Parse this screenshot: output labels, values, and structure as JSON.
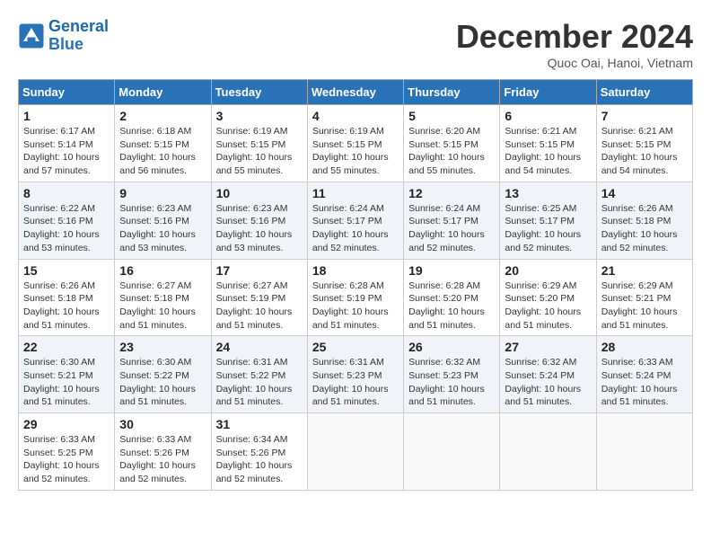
{
  "header": {
    "logo_line1": "General",
    "logo_line2": "Blue",
    "month_title": "December 2024",
    "subtitle": "Quoc Oai, Hanoi, Vietnam"
  },
  "weekdays": [
    "Sunday",
    "Monday",
    "Tuesday",
    "Wednesday",
    "Thursday",
    "Friday",
    "Saturday"
  ],
  "weeks": [
    [
      {
        "day": "1",
        "info": "Sunrise: 6:17 AM\nSunset: 5:14 PM\nDaylight: 10 hours\nand 57 minutes."
      },
      {
        "day": "2",
        "info": "Sunrise: 6:18 AM\nSunset: 5:15 PM\nDaylight: 10 hours\nand 56 minutes."
      },
      {
        "day": "3",
        "info": "Sunrise: 6:19 AM\nSunset: 5:15 PM\nDaylight: 10 hours\nand 55 minutes."
      },
      {
        "day": "4",
        "info": "Sunrise: 6:19 AM\nSunset: 5:15 PM\nDaylight: 10 hours\nand 55 minutes."
      },
      {
        "day": "5",
        "info": "Sunrise: 6:20 AM\nSunset: 5:15 PM\nDaylight: 10 hours\nand 55 minutes."
      },
      {
        "day": "6",
        "info": "Sunrise: 6:21 AM\nSunset: 5:15 PM\nDaylight: 10 hours\nand 54 minutes."
      },
      {
        "day": "7",
        "info": "Sunrise: 6:21 AM\nSunset: 5:15 PM\nDaylight: 10 hours\nand 54 minutes."
      }
    ],
    [
      {
        "day": "8",
        "info": "Sunrise: 6:22 AM\nSunset: 5:16 PM\nDaylight: 10 hours\nand 53 minutes."
      },
      {
        "day": "9",
        "info": "Sunrise: 6:23 AM\nSunset: 5:16 PM\nDaylight: 10 hours\nand 53 minutes."
      },
      {
        "day": "10",
        "info": "Sunrise: 6:23 AM\nSunset: 5:16 PM\nDaylight: 10 hours\nand 53 minutes."
      },
      {
        "day": "11",
        "info": "Sunrise: 6:24 AM\nSunset: 5:17 PM\nDaylight: 10 hours\nand 52 minutes."
      },
      {
        "day": "12",
        "info": "Sunrise: 6:24 AM\nSunset: 5:17 PM\nDaylight: 10 hours\nand 52 minutes."
      },
      {
        "day": "13",
        "info": "Sunrise: 6:25 AM\nSunset: 5:17 PM\nDaylight: 10 hours\nand 52 minutes."
      },
      {
        "day": "14",
        "info": "Sunrise: 6:26 AM\nSunset: 5:18 PM\nDaylight: 10 hours\nand 52 minutes."
      }
    ],
    [
      {
        "day": "15",
        "info": "Sunrise: 6:26 AM\nSunset: 5:18 PM\nDaylight: 10 hours\nand 51 minutes."
      },
      {
        "day": "16",
        "info": "Sunrise: 6:27 AM\nSunset: 5:18 PM\nDaylight: 10 hours\nand 51 minutes."
      },
      {
        "day": "17",
        "info": "Sunrise: 6:27 AM\nSunset: 5:19 PM\nDaylight: 10 hours\nand 51 minutes."
      },
      {
        "day": "18",
        "info": "Sunrise: 6:28 AM\nSunset: 5:19 PM\nDaylight: 10 hours\nand 51 minutes."
      },
      {
        "day": "19",
        "info": "Sunrise: 6:28 AM\nSunset: 5:20 PM\nDaylight: 10 hours\nand 51 minutes."
      },
      {
        "day": "20",
        "info": "Sunrise: 6:29 AM\nSunset: 5:20 PM\nDaylight: 10 hours\nand 51 minutes."
      },
      {
        "day": "21",
        "info": "Sunrise: 6:29 AM\nSunset: 5:21 PM\nDaylight: 10 hours\nand 51 minutes."
      }
    ],
    [
      {
        "day": "22",
        "info": "Sunrise: 6:30 AM\nSunset: 5:21 PM\nDaylight: 10 hours\nand 51 minutes."
      },
      {
        "day": "23",
        "info": "Sunrise: 6:30 AM\nSunset: 5:22 PM\nDaylight: 10 hours\nand 51 minutes."
      },
      {
        "day": "24",
        "info": "Sunrise: 6:31 AM\nSunset: 5:22 PM\nDaylight: 10 hours\nand 51 minutes."
      },
      {
        "day": "25",
        "info": "Sunrise: 6:31 AM\nSunset: 5:23 PM\nDaylight: 10 hours\nand 51 minutes."
      },
      {
        "day": "26",
        "info": "Sunrise: 6:32 AM\nSunset: 5:23 PM\nDaylight: 10 hours\nand 51 minutes."
      },
      {
        "day": "27",
        "info": "Sunrise: 6:32 AM\nSunset: 5:24 PM\nDaylight: 10 hours\nand 51 minutes."
      },
      {
        "day": "28",
        "info": "Sunrise: 6:33 AM\nSunset: 5:24 PM\nDaylight: 10 hours\nand 51 minutes."
      }
    ],
    [
      {
        "day": "29",
        "info": "Sunrise: 6:33 AM\nSunset: 5:25 PM\nDaylight: 10 hours\nand 52 minutes."
      },
      {
        "day": "30",
        "info": "Sunrise: 6:33 AM\nSunset: 5:26 PM\nDaylight: 10 hours\nand 52 minutes."
      },
      {
        "day": "31",
        "info": "Sunrise: 6:34 AM\nSunset: 5:26 PM\nDaylight: 10 hours\nand 52 minutes."
      },
      {
        "day": "",
        "info": ""
      },
      {
        "day": "",
        "info": ""
      },
      {
        "day": "",
        "info": ""
      },
      {
        "day": "",
        "info": ""
      }
    ]
  ]
}
